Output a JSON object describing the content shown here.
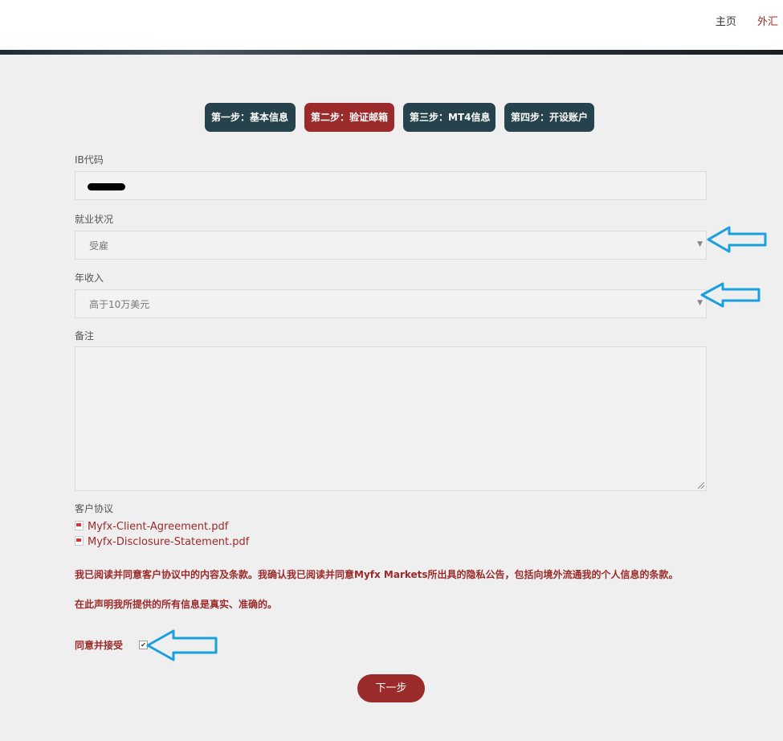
{
  "nav": {
    "home": "主页",
    "forex": "外汇"
  },
  "steps": [
    {
      "label": "第一步：基本信息",
      "active": false
    },
    {
      "label": "第二步：验证邮箱",
      "active": true
    },
    {
      "label": "第三步：MT4信息",
      "active": false
    },
    {
      "label": "第四步：开设账户",
      "active": false
    }
  ],
  "form": {
    "ib_code": {
      "label": "IB代码",
      "value": "[redacted]"
    },
    "employment": {
      "label": "就业状况",
      "value": "受雇"
    },
    "income": {
      "label": "年收入",
      "value": "高于10万美元"
    },
    "remarks": {
      "label": "备注",
      "value": ""
    },
    "agreement": {
      "label": "客户协议",
      "files": [
        "Myfx-Client-Agreement.pdf",
        "Myfx-Disclosure-Statement.pdf"
      ]
    },
    "notice1": "我已阅读并同意客户协议中的内容及条款。我确认我已阅读并同意Myfx Markets所出具的隐私公告，包括向境外流通我的个人信息的条款。",
    "notice2": "在此声明我所提供的所有信息是真实、准确的。",
    "agree_label": "同意并接受",
    "agree_checked": true
  },
  "buttons": {
    "next": "下一步"
  },
  "colors": {
    "accent": "#9b2a2a",
    "step_bg": "#25424d",
    "annotation_arrow": "#1aa0e0"
  }
}
